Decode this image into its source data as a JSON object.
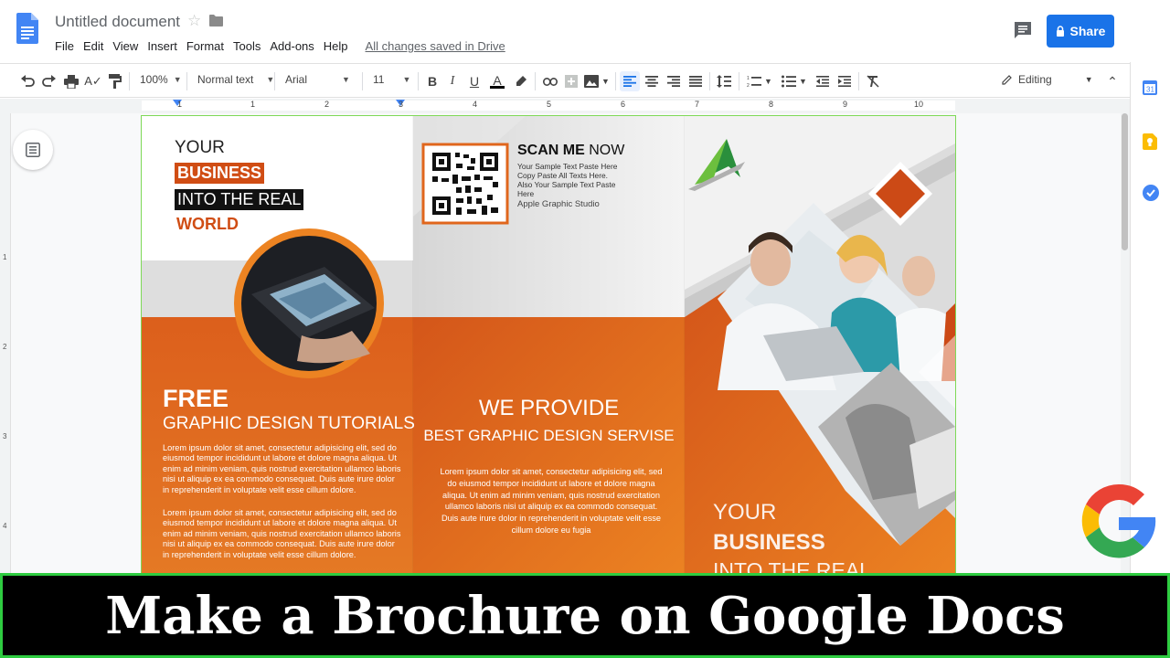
{
  "header": {
    "doc_title": "Untitled document",
    "menu": [
      "File",
      "Edit",
      "View",
      "Insert",
      "Format",
      "Tools",
      "Add-ons",
      "Help"
    ],
    "saved_status": "All changes saved in Drive",
    "share_label": "Share"
  },
  "toolbar": {
    "zoom": "100%",
    "style": "Normal text",
    "font": "Arial",
    "font_size": "11",
    "bold": "B",
    "italic": "I",
    "underline": "U",
    "text_color": "A",
    "mode": "Editing"
  },
  "ruler": {
    "numbers": [
      "1",
      "1",
      "2",
      "3",
      "4",
      "5",
      "6",
      "7",
      "8",
      "9",
      "10"
    ]
  },
  "vruler": {
    "numbers": [
      "1",
      "2",
      "3",
      "4"
    ]
  },
  "brochure": {
    "left": {
      "line1": "YOUR",
      "line2": "BUSINESS",
      "line3": "INTO THE REAL",
      "line4": "WORLD",
      "free": "FREE",
      "tutorials": "GRAPHIC DESIGN TUTORIALS",
      "para1": "Lorem ipsum dolor sit amet, consectetur adipisicing elit, sed do eiusmod tempor incididunt ut labore et dolore magna aliqua. Ut enim ad minim veniam, quis nostrud exercitation ullamco laboris nisi ut aliquip ex ea commodo consequat. Duis aute irure dolor in reprehenderit in voluptate velit esse cillum dolore.",
      "para2": "Lorem ipsum dolor sit amet, consectetur adipisicing elit, sed do eiusmod tempor incididunt ut labore et dolore magna aliqua. Ut enim ad minim veniam, quis nostrud exercitation ullamco laboris nisi ut aliquip ex ea commodo consequat. Duis aute irure dolor in reprehenderit in voluptate velit esse cillum dolore."
    },
    "middle": {
      "scan": "SCAN ME",
      "now": " NOW",
      "sample_lines": [
        "Your Sample Text Paste Here",
        "Copy Paste All Texts Here.",
        "Also Your Sample Text Paste",
        "Here"
      ],
      "studio": "Apple Graphic Studio",
      "we_provide": "WE PROVIDE",
      "best": "BEST GRAPHIC DESIGN SERVISE",
      "para": "Lorem ipsum dolor sit amet, consectetur adipisicing elit, sed do eiusmod tempor incididunt ut labore et dolore magna aliqua. Ut enim ad minim veniam, quis nostrud exercitation ullamco laboris nisi ut aliquip ex ea commodo consequat. Duis aute irure dolor in reprehenderit in voluptate velit esse cillum dolore eu fugia"
    },
    "right": {
      "line1": "YOUR",
      "line2": "BUSINESS",
      "line3": "INTO THE REAL"
    }
  },
  "banner": {
    "title": "Make a Brochure on Google Docs"
  },
  "colors": {
    "accent_orange": "#e0661c",
    "share_blue": "#1a73e8",
    "banner_border": "#2ecc40"
  },
  "icons": {
    "undo": "undo-icon",
    "redo": "redo-icon",
    "print": "print-icon",
    "spellcheck": "spellcheck-icon",
    "paint_format": "paint-format-icon",
    "link": "link-icon",
    "image": "image-icon",
    "align_left": "align-left-icon",
    "clear_format": "clear-format-icon"
  }
}
